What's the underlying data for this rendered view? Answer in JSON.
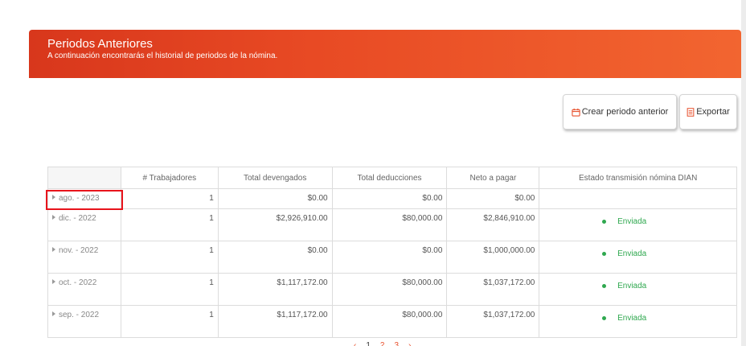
{
  "banner": {
    "title": "Periodos Anteriores",
    "subtitle": "A continuación encontrarás el historial de periodos de la nómina."
  },
  "toolbar": {
    "crear_label": "Crear periodo anterior",
    "exportar_label": "Exportar"
  },
  "table": {
    "columns": [
      "",
      "# Trabajadores",
      "Total devengados",
      "Total deducciones",
      "Neto a pagar",
      "Estado transmisión nómina DIAN"
    ],
    "rows": [
      {
        "period": "ago. - 2023",
        "workers": "1",
        "devengados": "$0.00",
        "deducciones": "$0.00",
        "neto": "$0.00",
        "status": ""
      },
      {
        "period": "dic. - 2022",
        "workers": "1",
        "devengados": "$2,926,910.00",
        "deducciones": "$80,000.00",
        "neto": "$2,846,910.00",
        "status": "Enviada"
      },
      {
        "period": "nov. - 2022",
        "workers": "1",
        "devengados": "$0.00",
        "deducciones": "$0.00",
        "neto": "$1,000,000.00",
        "status": "Enviada"
      },
      {
        "period": "oct. - 2022",
        "workers": "1",
        "devengados": "$1,117,172.00",
        "deducciones": "$80,000.00",
        "neto": "$1,037,172.00",
        "status": "Enviada"
      },
      {
        "period": "sep. - 2022",
        "workers": "1",
        "devengados": "$1,117,172.00",
        "deducciones": "$80,000.00",
        "neto": "$1,037,172.00",
        "status": "Enviada"
      }
    ]
  },
  "pager": {
    "items": [
      "‹",
      "1",
      "2",
      "3",
      "›"
    ]
  },
  "colors": {
    "banner_start": "#d8371c",
    "banner_end": "#f26530",
    "status_ok": "#2fa84f",
    "highlight": "#e8141c"
  }
}
